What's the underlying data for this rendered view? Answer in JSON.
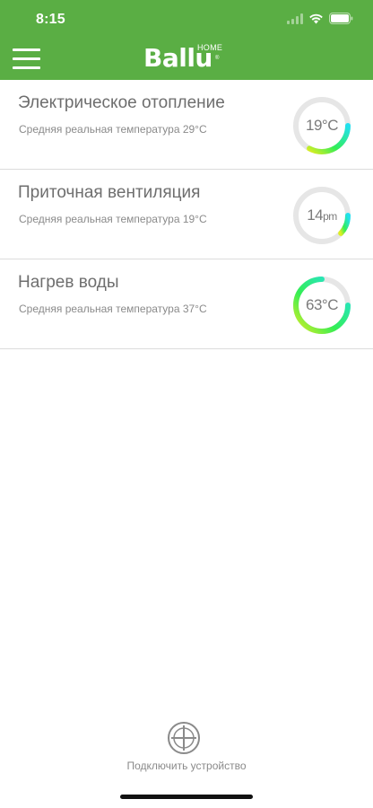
{
  "status_bar": {
    "time": "8:15"
  },
  "header": {
    "logo_text": "Ballu",
    "logo_home": "HOME",
    "logo_registered": "®"
  },
  "devices": [
    {
      "title": "Электрическое отопление",
      "subtitle": "Средняя реальная температура  29°C",
      "gauge_value": "19",
      "gauge_unit": "°C",
      "gauge_fill": 0.33
    },
    {
      "title": "Приточная вентиляция",
      "subtitle": "Средняя реальная температура  19°C",
      "gauge_value": "14",
      "gauge_unit": "pm",
      "gauge_fill": 0.12
    },
    {
      "title": "Нагрев воды",
      "subtitle": "Средняя реальная температура  37°C",
      "gauge_value": "63",
      "gauge_unit": "°C",
      "gauge_fill": 0.75
    }
  ],
  "footer": {
    "add_device_label": "Подключить устройство"
  },
  "colors": {
    "header_green": "#5aae44",
    "gauge_track": "#e6e6e6",
    "gauge_cyan": "#22e0f0",
    "gauge_green": "#33ee55",
    "gauge_yellow": "#ddee22"
  }
}
